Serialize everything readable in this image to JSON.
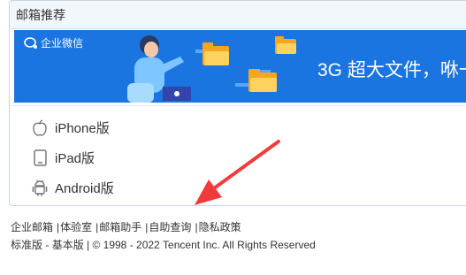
{
  "panel": {
    "title": "邮箱推荐",
    "banner": {
      "brand": "企业微信",
      "headline": "3G 超大文件，咻一"
    },
    "apps": [
      {
        "label": "iPhone版",
        "icon": "apple-icon"
      },
      {
        "label": "iPad版",
        "icon": "tablet-icon"
      },
      {
        "label": "Android版",
        "icon": "android-icon"
      }
    ]
  },
  "footer": {
    "links": [
      "企业邮箱",
      "体验室",
      "邮箱助手",
      "自助查询",
      "隐私政策"
    ],
    "separator": "|",
    "version_standard": "标准版",
    "version_dash": " - ",
    "version_basic": "基本版",
    "copyright": " | © 1998 - 2022 Tencent Inc. All Rights Reserved"
  },
  "annotation": {
    "icon": "red-arrow-icon",
    "color": "#f23a3a"
  },
  "colors": {
    "banner": "#1a75e0",
    "header_bg": "#f2f7fc",
    "border": "#c8d3e2"
  }
}
